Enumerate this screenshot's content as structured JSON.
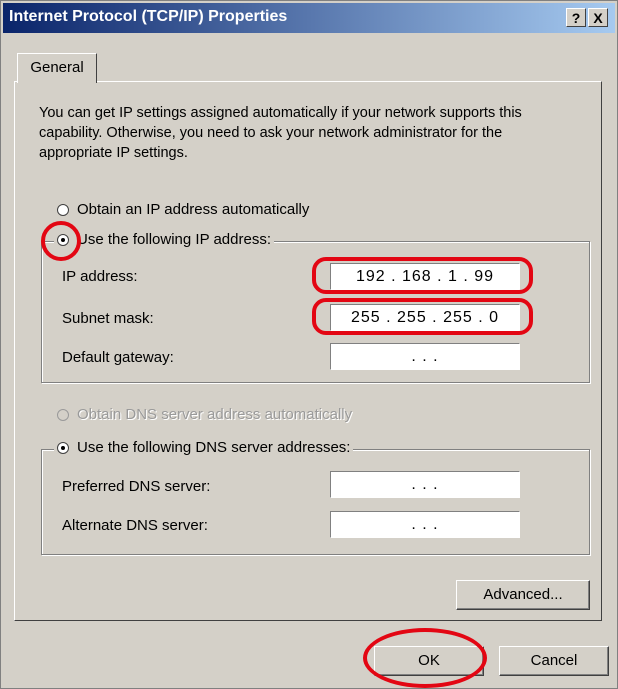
{
  "window": {
    "title": "Internet Protocol (TCP/IP) Properties",
    "help_button": "?",
    "close_button": "X"
  },
  "tabs": [
    {
      "label": "General"
    }
  ],
  "description": "You can get IP settings assigned automatically if your network supports this capability. Otherwise, you need to ask your network administrator for the appropriate IP settings.",
  "ip_section": {
    "auto_option": "Obtain an IP address automatically",
    "manual_option": "Use the following IP address:",
    "selected": "manual",
    "fields": [
      {
        "label": "IP address:",
        "value": "192 . 168 .  1  . 99"
      },
      {
        "label": "Subnet mask:",
        "value": "255 . 255 . 255 . 0"
      },
      {
        "label": "Default gateway:",
        "value": ".     .     ."
      }
    ]
  },
  "dns_section": {
    "auto_option": "Obtain DNS server address automatically",
    "auto_disabled": true,
    "manual_option": "Use the following DNS server addresses:",
    "selected": "manual",
    "fields": [
      {
        "label": "Preferred DNS server:",
        "value": ".     .     ."
      },
      {
        "label": "Alternate DNS server:",
        "value": ".     .     ."
      }
    ]
  },
  "buttons": {
    "advanced": "Advanced...",
    "ok": "OK",
    "cancel": "Cancel"
  },
  "annotation_color": "#e30613"
}
